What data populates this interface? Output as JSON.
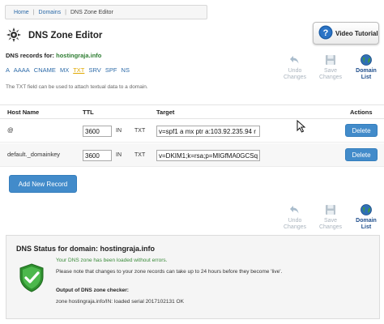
{
  "breadcrumb": {
    "home": "Home",
    "domains": "Domains",
    "current": "DNS Zone Editor"
  },
  "header": {
    "title": "DNS Zone Editor",
    "video_label": "Video Tutorial"
  },
  "records_for": {
    "label": "DNS records for:",
    "domain": "hostingraja.info"
  },
  "record_types": [
    "A",
    "AAAA",
    "CNAME",
    "MX",
    "TXT",
    "SRV",
    "SPF",
    "NS"
  ],
  "active_type": "TXT",
  "txt_note": "The TXT field can be used to attach textual data to a domain.",
  "toolbar": {
    "undo": [
      "Undo",
      "Changes"
    ],
    "save": [
      "Save",
      "Changes"
    ],
    "list": [
      "Domain",
      "List"
    ]
  },
  "table": {
    "headers": {
      "host": "Host Name",
      "ttl": "TTL",
      "target": "Target",
      "actions": "Actions"
    },
    "rows": [
      {
        "host": "@",
        "ttl": "3600",
        "in": "IN",
        "type": "TXT",
        "target": "v=spf1 a mx ptr a:103.92.235.94 r",
        "delete": "Delete"
      },
      {
        "host": "default._domainkey",
        "ttl": "3600",
        "in": "IN",
        "type": "TXT",
        "target": "v=DKIM1;k=rsa;p=MIGfMA0GCSq",
        "delete": "Delete"
      }
    ]
  },
  "add_record": "Add New Record",
  "status": {
    "title": "DNS Status for domain: hostingraja.info",
    "loaded": "Your DNS zone has been loaded without errors.",
    "note": "Please note that changes to your zone records can take up to 24 hours before they become 'live'.",
    "output_label": "Output of DNS zone checker:",
    "output_value": "zone hostingraja.info/IN: loaded serial 2017102131 OK"
  },
  "colors": {
    "primary_button": "#428bca",
    "link": "#2c6aa8",
    "success": "#3c8c3c",
    "active_type": "#e0a800"
  }
}
